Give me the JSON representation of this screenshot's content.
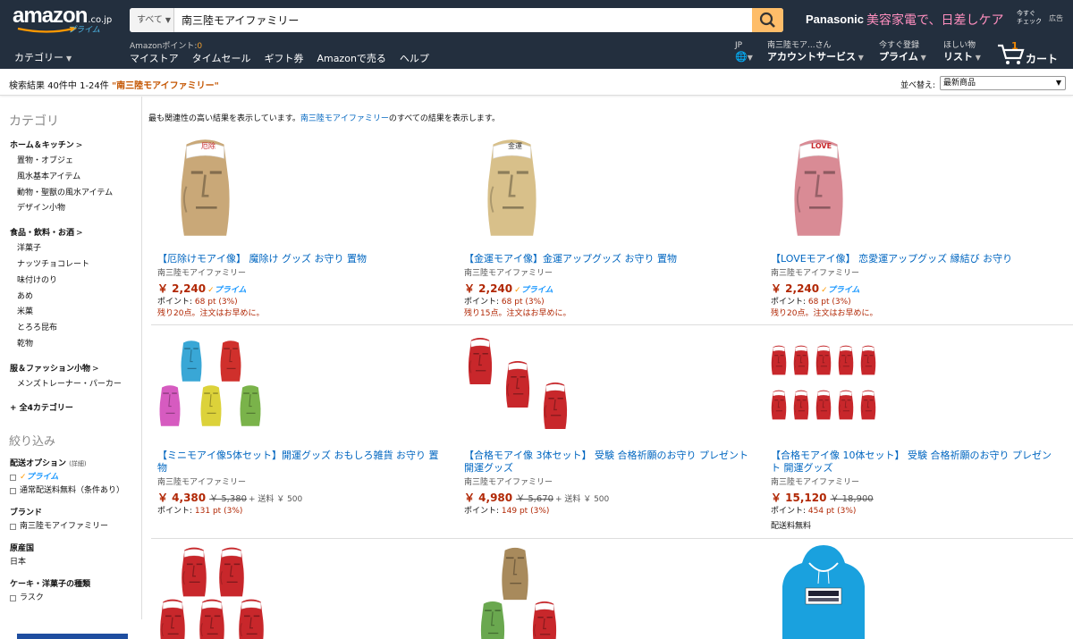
{
  "header": {
    "logo_text": "amazon",
    "logo_tld": ".co.jp",
    "logo_prime": "プライム",
    "search": {
      "department": "すべて",
      "query": "南三陸モアイファミリー"
    },
    "promo": {
      "brand": "Panasonic",
      "tagline": "美容家電で、日差しケア",
      "check_line1": "今すぐ",
      "check_line2": "チェック",
      "ad_label": "広告"
    },
    "category_button": "カテゴリー",
    "points_label": "Amazonポイント:",
    "points_value": "0",
    "nav": [
      "マイストア",
      "タイムセール",
      "ギフト券",
      "Amazonで売る",
      "ヘルプ"
    ],
    "lang_small": "JP",
    "account_small": "南三陸モア...さん",
    "account_big": "アカウントサービス",
    "prime_small": "今すぐ登録",
    "prime_big": "プライム",
    "wish_small": "ほしい物",
    "wish_big": "リスト",
    "cart_count": "1",
    "cart_label": "カート"
  },
  "results_bar": {
    "info": "検索結果 40件中 1-24件",
    "query": "\"南三陸モアイファミリー\"",
    "sort_label": "並べ替え:",
    "sort_value": "最新商品"
  },
  "sidebar": {
    "category_heading": "カテゴリ",
    "groups": [
      {
        "title": "ホーム＆キッチン",
        "items": [
          "置物・オブジェ",
          "風水基本アイテム",
          "動物・聖獣の風水アイテム",
          "デザイン小物"
        ]
      },
      {
        "title": "食品・飲料・お酒",
        "items": [
          "洋菓子",
          "ナッツチョコレート",
          "味付けのり",
          "あめ",
          "米菓",
          "とろろ昆布",
          "乾物"
        ]
      },
      {
        "title": "服＆ファッション小物",
        "items": [
          "メンズトレーナー・パーカー"
        ]
      }
    ],
    "more_categories": "+ 全4カテゴリー",
    "refine_heading": "絞り込み",
    "shipping_title": "配送オプション",
    "shipping_detail": "(詳細)",
    "shipping_prime": "プライム",
    "shipping_free": "通常配送料無料（条件あり）",
    "brand_title": "ブランド",
    "brand_option": "南三陸モアイファミリー",
    "origin_title": "原産国",
    "origin_value": "日本",
    "cake_title": "ケーキ・洋菓子の種類",
    "cake_option": "ラスク"
  },
  "relevance": {
    "prefix": "最も関連性の高い結果を表示しています。",
    "link": "南三陸モアイファミリー",
    "suffix": "のすべての結果を表示します。"
  },
  "products": [
    {
      "title": "【厄除けモアイ像】 魔除け グッズ お守り 置物",
      "brand": "南三陸モアイファミリー",
      "price": "￥ 2,240",
      "prime": "プライム",
      "points": "68 pt",
      "points_pct": "(3%)",
      "stock": "残り20点。注文はお早めに。",
      "headband": "厄除"
    },
    {
      "title": "【金運モアイ像】金運アップグッズ お守り 置物",
      "brand": "南三陸モアイファミリー",
      "price": "￥ 2,240",
      "prime": "プライム",
      "points": "68 pt",
      "points_pct": "(3%)",
      "stock": "残り15点。注文はお早めに。",
      "headband": "金運"
    },
    {
      "title": "【LOVEモアイ像】 恋愛運アップグッズ 縁結び お守り",
      "brand": "南三陸モアイファミリー",
      "price": "￥ 2,240",
      "prime": "プライム",
      "points": "68 pt",
      "points_pct": "(3%)",
      "stock": "残り20点。注文はお早めに。",
      "headband": "LOVE"
    },
    {
      "title": "【ミニモアイ像5体セット】開運グッズ おもしろ雑貨 お守り 置物",
      "brand": "南三陸モアイファミリー",
      "price": "￥ 4,380",
      "list_price": "￥ 5,380",
      "shipping": "+ 送料 ￥ 500",
      "points": "131 pt",
      "points_pct": "(3%)"
    },
    {
      "title": "【合格モアイ像 3体セット】 受験 合格祈願のお守り プレゼント 開運グッズ",
      "brand": "南三陸モアイファミリー",
      "price": "￥ 4,980",
      "list_price": "￥ 5,670",
      "shipping": "+ 送料 ￥ 500",
      "points": "149 pt",
      "points_pct": "(3%)"
    },
    {
      "title": "【合格モアイ像 10体セット】 受験 合格祈願のお守り プレゼント 開運グッズ",
      "brand": "南三陸モアイファミリー",
      "price": "￥ 15,120",
      "list_price": "￥ 18,900",
      "points": "454 pt",
      "points_pct": "(3%)",
      "free_shipping": "配送料無料"
    }
  ],
  "points_label": "ポイント:",
  "colors": {
    "header_bg": "#232f3e",
    "search_button": "#febd69",
    "link": "#0066c0",
    "price": "#b12704",
    "prime_blue": "#1a98ff",
    "moai_red": "#c8272b",
    "moai_sand": "#c9a878",
    "moai_gold": "#d8c08a",
    "moai_pink": "#d98b95",
    "hoodie_blue": "#1aa1de"
  }
}
